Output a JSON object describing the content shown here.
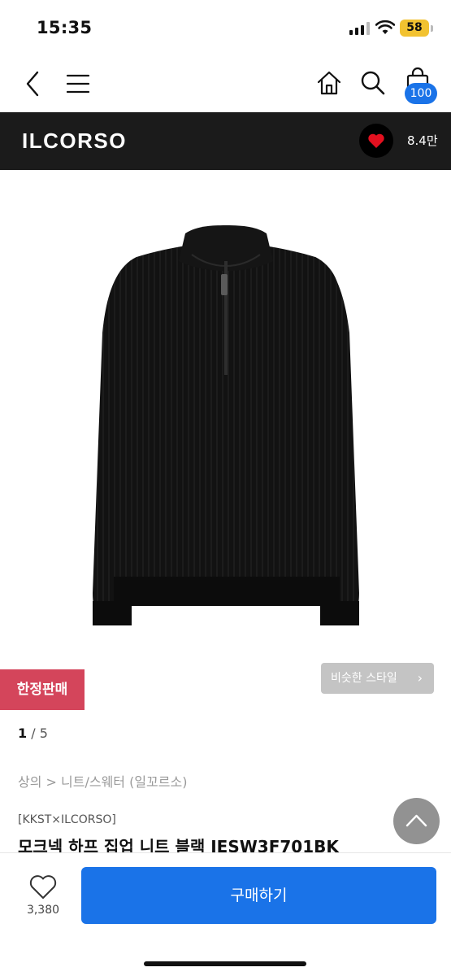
{
  "status_bar": {
    "time": "15:35",
    "battery": "58"
  },
  "nav": {
    "cart_count": "100"
  },
  "brand": {
    "name": "ILCORSO",
    "like_count": "8.4만"
  },
  "badges": {
    "limited": "한정판매",
    "similar_style": "비슷한 스타일",
    "similar_chevron": "›"
  },
  "gallery": {
    "current": "1",
    "separator": " / ",
    "total": "5"
  },
  "product": {
    "breadcrumb": "상의 > 니트/스웨터 (일꼬르소)",
    "collab": "[KKST×ILCORSO]",
    "title": "모크넥 하프 집업 니트 블랙 IESW3F701BK"
  },
  "bottom": {
    "wish_count": "3,380",
    "buy_label": "구매하기"
  },
  "colors": {
    "accent": "#1a73e8",
    "limited_badge": "#d4455b",
    "brand_bar": "#1b1b1b",
    "heart": "#e3101f"
  }
}
